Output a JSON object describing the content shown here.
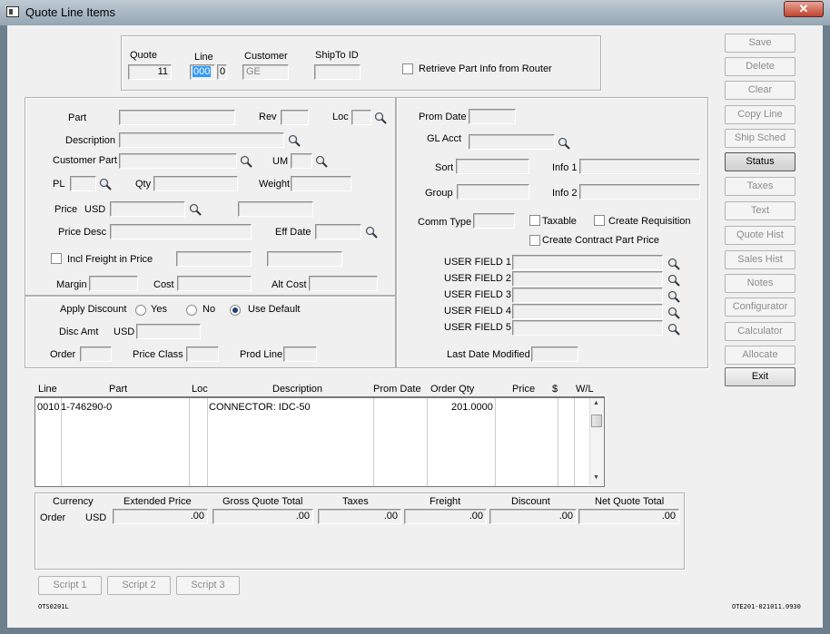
{
  "window": {
    "title": "Quote Line Items",
    "close_label": "✕"
  },
  "header": {
    "quote_label": "Quote",
    "quote_value": "11",
    "line_label": "Line",
    "line_value": "000",
    "line_sub_value": "0",
    "customer_label": "Customer",
    "customer_value": "GE",
    "shipto_label": "ShipTo ID",
    "shipto_value": "",
    "retrieve_label": "Retrieve Part Info from Router"
  },
  "part_section": {
    "part_label": "Part",
    "rev_label": "Rev",
    "loc_label": "Loc",
    "description_label": "Description",
    "customer_part_label": "Customer Part",
    "um_label": "UM",
    "pl_label": "PL",
    "qty_label": "Qty",
    "weight_label": "Weight",
    "price_label": "Price",
    "price_currency": "USD",
    "price_desc_label": "Price Desc",
    "eff_date_label": "Eff Date",
    "incl_freight_label": "Incl Freight in Price",
    "margin_label": "Margin",
    "cost_label": "Cost",
    "alt_cost_label": "Alt Cost"
  },
  "discount_section": {
    "apply_discount_label": "Apply Discount",
    "yes_label": "Yes",
    "no_label": "No",
    "use_default_label": "Use Default",
    "selected": "use_default",
    "disc_amt_label": "Disc Amt",
    "disc_currency": "USD",
    "order_label": "Order",
    "price_class_label": "Price Class",
    "prod_line_label": "Prod Line"
  },
  "right_section": {
    "prom_date_label": "Prom Date",
    "gl_acct_label": "GL Acct",
    "sort_label": "Sort",
    "info1_label": "Info 1",
    "group_label": "Group",
    "info2_label": "Info 2",
    "comm_type_label": "Comm Type",
    "taxable_label": "Taxable",
    "create_requisition_label": "Create Requisition",
    "create_contract_label": "Create Contract Part Price",
    "user_fields": [
      "USER FIELD 1",
      "USER FIELD 2",
      "USER FIELD 3",
      "USER FIELD 4",
      "USER FIELD 5"
    ],
    "last_date_modified_label": "Last Date Modified"
  },
  "side_buttons": [
    {
      "label": "Save",
      "enabled": false
    },
    {
      "label": "Delete",
      "enabled": false
    },
    {
      "label": "Clear",
      "enabled": false
    },
    {
      "label": "Copy Line",
      "enabled": false
    },
    {
      "label": "Ship Sched",
      "enabled": false
    },
    {
      "label": "Status",
      "enabled": true
    },
    {
      "label": "Taxes",
      "enabled": false
    },
    {
      "label": "Text",
      "enabled": false
    },
    {
      "label": "Quote Hist",
      "enabled": false
    },
    {
      "label": "Sales Hist",
      "enabled": false
    },
    {
      "label": "Notes",
      "enabled": false
    },
    {
      "label": "Configurator",
      "enabled": false
    },
    {
      "label": "Calculator",
      "enabled": false
    },
    {
      "label": "Allocate",
      "enabled": false
    },
    {
      "label": "Exit",
      "enabled": true
    }
  ],
  "lines_table": {
    "columns": [
      "Line",
      "Part",
      "Loc",
      "Description",
      "Prom Date",
      "Order Qty",
      "Price",
      "$",
      "W/L"
    ],
    "rows": [
      {
        "line": "0010",
        "part": "1-746290-0",
        "loc": "",
        "description": "CONNECTOR: IDC-50",
        "prom_date": "",
        "order_qty": "201.0000",
        "price": "",
        "currency": "",
        "wl": ""
      }
    ]
  },
  "totals": {
    "currency_label": "Currency",
    "extended_price_label": "Extended Price",
    "gross_total_label": "Gross Quote Total",
    "taxes_label": "Taxes",
    "freight_label": "Freight",
    "discount_label": "Discount",
    "net_total_label": "Net Quote Total",
    "row_label": "Order",
    "row_currency": "USD",
    "extended_price": ".00",
    "gross_total": ".00",
    "taxes": ".00",
    "freight": ".00",
    "discount": ".00",
    "net_total": ".00"
  },
  "script_buttons": [
    "Script 1",
    "Script 2",
    "Script 3"
  ],
  "footer": {
    "left_code": "OTS0201L",
    "right_code": "OTE201-021011.0930"
  }
}
